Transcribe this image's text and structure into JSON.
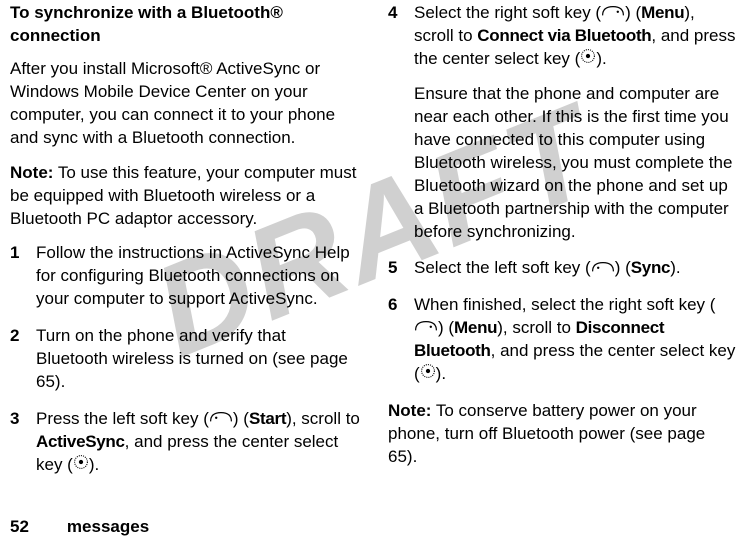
{
  "watermark": "DRAFT",
  "left": {
    "heading": "To synchronize with a Bluetooth® connection",
    "intro": "After you install Microsoft® ActiveSync or Windows Mobile Device Center on your computer, you can connect it to your phone and sync with a Bluetooth connection.",
    "note_label": "Note:",
    "note_body": " To use this feature, your computer must be equipped with Bluetooth wireless or a Bluetooth PC adaptor accessory.",
    "steps": [
      {
        "num": "1",
        "body": "Follow the instructions in ActiveSync Help for configuring Bluetooth connections on your computer to support ActiveSync."
      },
      {
        "num": "2",
        "body": "Turn on the phone and verify that Bluetooth wireless is turned on (see page 65)."
      }
    ],
    "step3": {
      "num": "3",
      "a": "Press the left soft key (",
      "b": ") (",
      "start": "Start",
      "c": "), scroll to ",
      "activesync": "ActiveSync",
      "d": ", and press the center select key (",
      "e": ")."
    }
  },
  "right": {
    "step4": {
      "num": "4",
      "a": "Select the right soft key (",
      "b": ") (",
      "menu": "Menu",
      "c": "), scroll to  ",
      "connect": "Connect via Bluetooth",
      "d": ", and press the center select key (",
      "e": ")."
    },
    "step4_para": "Ensure that the phone and computer are near each other. If this is the first time you have connected to this computer using Bluetooth wireless, you must complete the Bluetooth wizard on the phone and set up a Bluetooth partnership with the computer before synchronizing.",
    "step5": {
      "num": "5",
      "a": "Select the left soft key (",
      "b": ") (",
      "sync": "Sync",
      "c": ")."
    },
    "step6": {
      "num": "6",
      "a": "When finished, select the right soft key (",
      "b": ") (",
      "menu": "Menu",
      "c": "), scroll to ",
      "disconnect": "Disconnect Bluetooth",
      "d": ", and press the center select key (",
      "e": ")."
    },
    "note_label": "Note:",
    "note_body": " To conserve battery power on your phone, turn off Bluetooth power (see page 65)."
  },
  "footer": {
    "page": "52",
    "section": "messages"
  }
}
